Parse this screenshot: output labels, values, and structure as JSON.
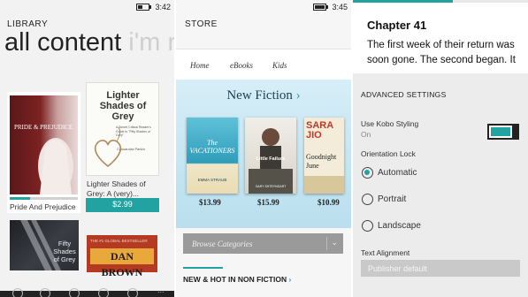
{
  "library": {
    "status_time": "3:42",
    "header": "LIBRARY",
    "title": "all content",
    "title_faded": "i'm r",
    "books": [
      {
        "title": "Pride And Prejudice",
        "cover_text": "PRIDE & PREJUDICE",
        "progress": 0.3
      },
      {
        "title": "Lighter Shades of Grey: A (very)...",
        "cover_text": "Lighter Shades of Grey",
        "cover_sub": "A Secret Critical Reader's Guide to \"Fifty Shades of Grey\"",
        "cover_author": "Cassandra Parkin",
        "price": "$2.99"
      },
      {
        "title": "Fifty Shades of Grey",
        "cover_text": "Fifty Shades of Grey"
      },
      {
        "title": "Dan Brown",
        "cover_text": "DAN BROWN",
        "cover_top": "THE #1 GLOBAL BESTSELLER"
      }
    ]
  },
  "store": {
    "status_time": "3:45",
    "header": "STORE",
    "nav": [
      "Home",
      "eBooks",
      "Kids"
    ],
    "section_title": "New Fiction",
    "section_chevron": "›",
    "books": [
      {
        "cover_title": "The VACATIONERS",
        "cover_author": "EMMA STRAUB",
        "price": "$13.99"
      },
      {
        "cover_title": "Little Failure",
        "cover_author": "GARY SHTEYNGART",
        "price": "$15.99"
      },
      {
        "cover_title": "SARA JIO",
        "cover_author": "Goodnight June",
        "price": "$10.99"
      }
    ],
    "browse_label": "Browse Categories",
    "browse_chevron": "⌄",
    "nonfiction_label": "NEW & HOT IN NON FICTION",
    "nonfiction_chevron": "›"
  },
  "reader": {
    "chapter": "Chapter 41",
    "text": "The first week of their return was soon gone. The second began. It",
    "settings": {
      "header": "ADVANCED SETTINGS",
      "kobo_styling_label": "Use Kobo Styling",
      "kobo_styling_value": "On",
      "orientation_label": "Orientation Lock",
      "orientation_options": [
        "Automatic",
        "Portrait",
        "Landscape"
      ],
      "orientation_selected": "Automatic",
      "text_alignment_label": "Text Alignment",
      "text_alignment_value": "Publisher default"
    }
  },
  "colors": {
    "accent": "#23a2a2"
  }
}
